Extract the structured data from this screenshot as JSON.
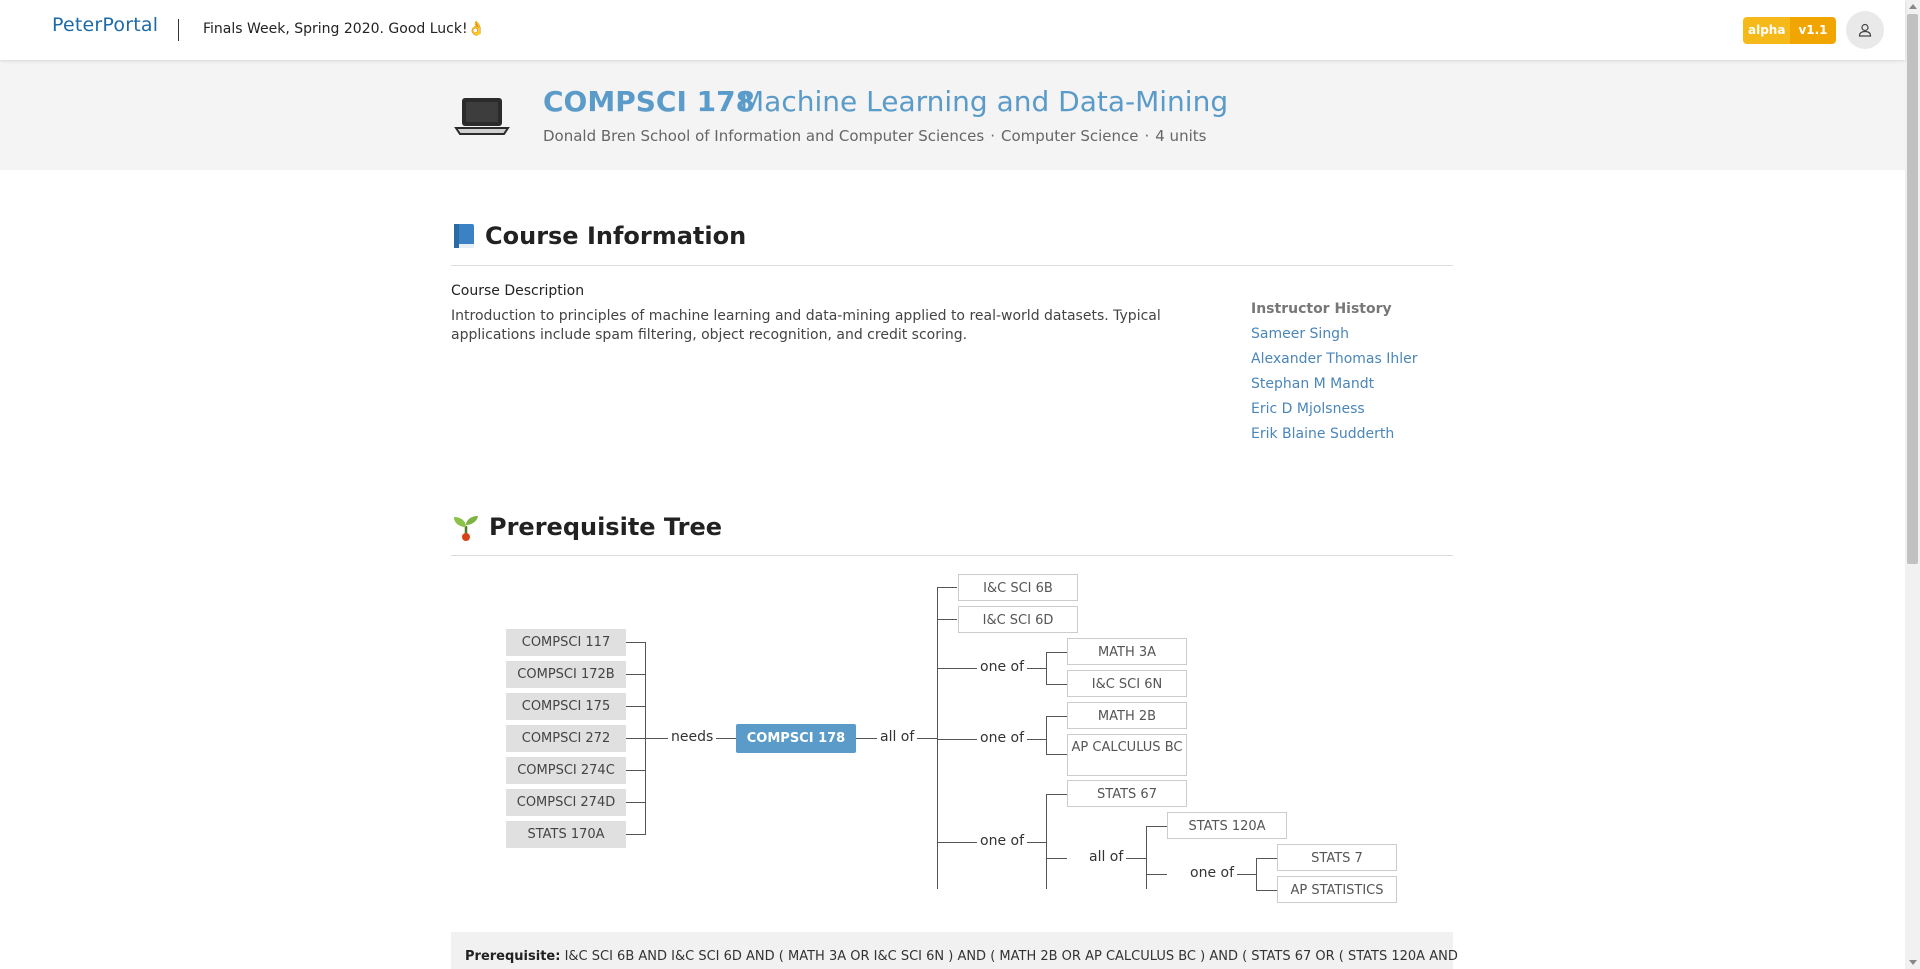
{
  "header": {
    "logo_text": "PeterPortal",
    "announcement": "Finals Week, Spring 2020. Good Luck!👌",
    "badge_left": "alpha",
    "badge_right": "v1.1",
    "user_icon": "user-icon"
  },
  "course": {
    "icon": "laptop-icon",
    "code": "COMPSCI 178",
    "title": "Machine Learning and Data-Mining",
    "school": "Donald Bren School of Information and Computer Sciences",
    "department": "Computer Science",
    "units": "4 units",
    "separator": "·"
  },
  "course_info": {
    "heading_icon": "book-icon",
    "heading": "Course Information",
    "description_label": "Course Description",
    "description": "Introduction to principles of machine learning and data-mining applied to real-world datasets. Typical applications include spam filtering, object recognition, and credit scoring.",
    "instructor_label": "Instructor History",
    "instructors": [
      "Sameer Singh",
      "Alexander Thomas Ihler",
      "Stephan M Mandt",
      "Eric D Mjolsness",
      "Erik Blaine Sudderth"
    ]
  },
  "prereq_tree": {
    "heading_icon": "sprout-icon",
    "heading": "Prerequisite Tree",
    "dependents": [
      "COMPSCI 117",
      "COMPSCI 172B",
      "COMPSCI 175",
      "COMPSCI 272",
      "COMPSCI 274C",
      "COMPSCI 274D",
      "STATS 170A"
    ],
    "needs_label": "needs",
    "center_course": "COMPSCI 178",
    "all_of_label": "all of",
    "one_of_label": "one of",
    "prereqs": {
      "a": "I&C SCI 6B",
      "b": "I&C SCI 6D",
      "g1": [
        "MATH 3A",
        "I&C SCI 6N"
      ],
      "g2": [
        "MATH 2B",
        "AP CALCULUS BC"
      ],
      "g3_first": "STATS 67",
      "g3_sub_first": "STATS 120A",
      "g3_sub_one": [
        "STATS 7",
        "AP STATISTICS"
      ]
    }
  },
  "prerequisite_text": {
    "label": "Prerequisite:",
    "text": "I&C SCI 6B AND I&C SCI 6D AND ( MATH 3A OR I&C SCI 6N ) AND ( MATH 2B OR AP CALCULUS BC ) AND ( STATS 67 OR ( STATS 120A AND"
  }
}
